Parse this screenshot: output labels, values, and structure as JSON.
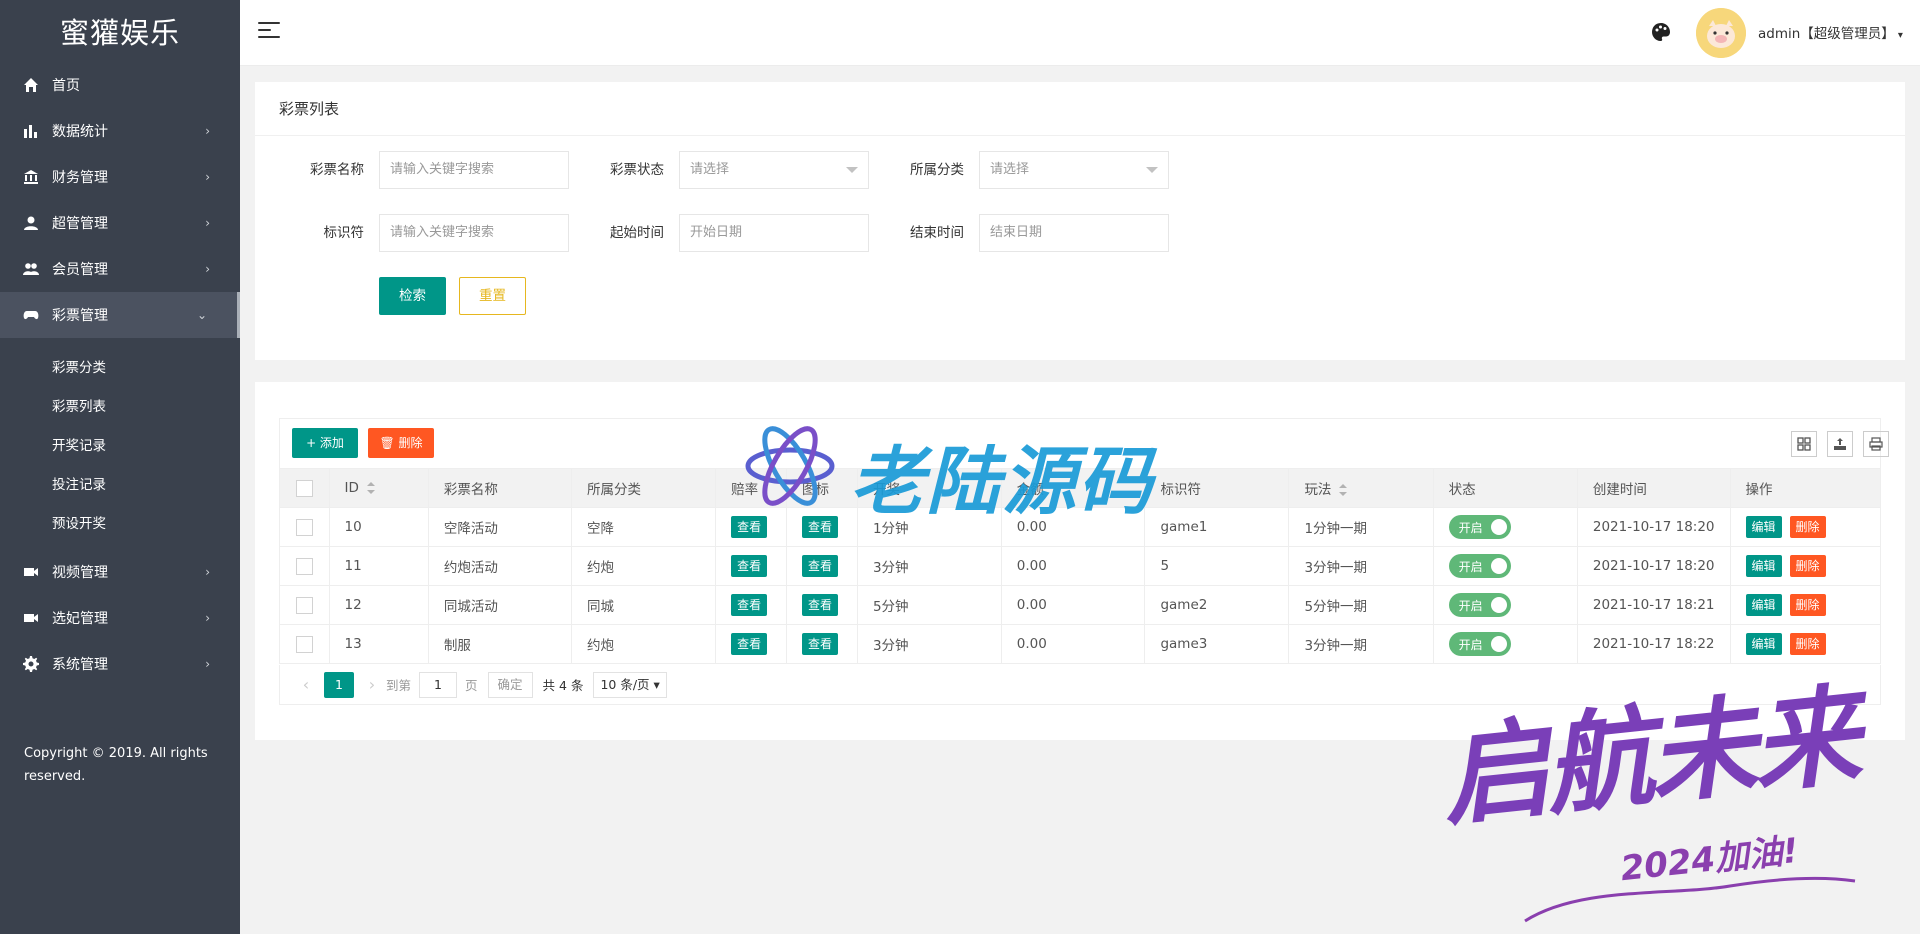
{
  "sidebar": {
    "logo": "蜜獾娱乐",
    "items": [
      {
        "label": "首页",
        "icon": "home-icon",
        "arrow": ""
      },
      {
        "label": "数据统计",
        "icon": "bar-chart-icon",
        "arrow": "›"
      },
      {
        "label": "财务管理",
        "icon": "bank-icon",
        "arrow": "›"
      },
      {
        "label": "超管管理",
        "icon": "user-icon",
        "arrow": "›"
      },
      {
        "label": "会员管理",
        "icon": "users-icon",
        "arrow": "›"
      },
      {
        "label": "彩票管理",
        "icon": "gamepad-icon",
        "arrow": "⌄"
      }
    ],
    "sub_items": [
      {
        "label": "彩票分类"
      },
      {
        "label": "彩票列表"
      },
      {
        "label": "开奖记录"
      },
      {
        "label": "投注记录"
      },
      {
        "label": "预设开奖"
      }
    ],
    "items_after": [
      {
        "label": "视频管理",
        "icon": "video-icon",
        "arrow": "›"
      },
      {
        "label": "选妃管理",
        "icon": "video-icon",
        "arrow": "›"
      },
      {
        "label": "系统管理",
        "icon": "gear-icon",
        "arrow": "›"
      }
    ],
    "copyright": "Copyright © 2019. All rights reserved."
  },
  "header": {
    "user": "admin【超级管理员】",
    "caret": "▾"
  },
  "search": {
    "title": "彩票列表",
    "fields": {
      "name_label": "彩票名称",
      "name_placeholder": "请输入关键字搜索",
      "status_label": "彩票状态",
      "status_placeholder": "请选择",
      "category_label": "所属分类",
      "category_placeholder": "请选择",
      "key_label": "标识符",
      "key_placeholder": "请输入关键字搜索",
      "start_label": "起始时间",
      "start_placeholder": "开始日期",
      "end_label": "结束时间",
      "end_placeholder": "结束日期"
    },
    "search_button": "检索",
    "reset_button": "重置"
  },
  "table": {
    "add_button": "+ 添加",
    "delete_button": "删除",
    "columns": [
      "ID",
      "彩票名称",
      "所属分类",
      "赔率",
      "图标",
      "开奖",
      "金额",
      "标识符",
      "玩法",
      "状态",
      "创建时间",
      "操作"
    ],
    "view_label": "查看",
    "edit_label": "编辑",
    "delete_label": "删除",
    "rows": [
      {
        "id": "10",
        "name": "空降活动",
        "category": "空降",
        "period": "1分钟",
        "amount": "0.00",
        "key": "game1",
        "play": "1分钟一期",
        "status": "开启",
        "created": "2021-10-17 18:20"
      },
      {
        "id": "11",
        "name": "约炮活动",
        "category": "约炮",
        "period": "3分钟",
        "amount": "0.00",
        "key": "5",
        "play": "3分钟一期",
        "status": "开启",
        "created": "2021-10-17 18:20"
      },
      {
        "id": "12",
        "name": "同城活动",
        "category": "同城",
        "period": "5分钟",
        "amount": "0.00",
        "key": "game2",
        "play": "5分钟一期",
        "status": "开启",
        "created": "2021-10-17 18:21"
      },
      {
        "id": "13",
        "name": "制服",
        "category": "约炮",
        "period": "3分钟",
        "amount": "0.00",
        "key": "game3",
        "play": "3分钟一期",
        "status": "开启",
        "created": "2021-10-17 18:22"
      }
    ]
  },
  "pager": {
    "current": "1",
    "goto_label": "到第",
    "goto_value": "1",
    "page_label": "页",
    "confirm": "确定",
    "total": "共 4 条",
    "page_size": "10 条/页"
  },
  "watermarks": {
    "top": "老陆源码",
    "bottom_big": "启航未来",
    "bottom_small": "2024加油!"
  },
  "colors": {
    "sidebar": "#3a414d",
    "primary": "#009688",
    "danger": "#ff5722",
    "warning": "#e6b71f",
    "switch_on": "#5fb878"
  }
}
